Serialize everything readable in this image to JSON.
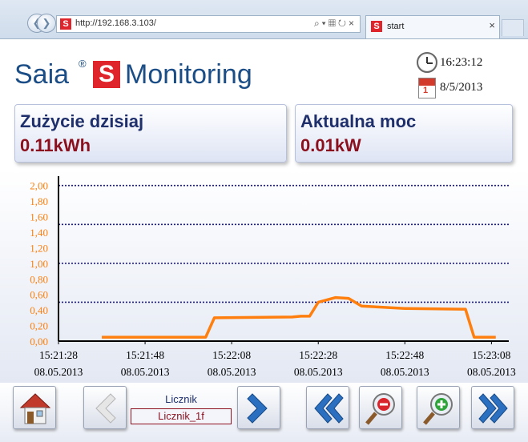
{
  "browser": {
    "url": "http://192.168.3.103/",
    "tab_title": "start",
    "favicon_letter": "S"
  },
  "logo": {
    "saia": "Saia",
    "reg": "®",
    "s": "S",
    "monitoring": "Monitoring"
  },
  "header": {
    "time": "16:23:12",
    "date": "8/5/2013"
  },
  "panels": {
    "energy": {
      "title": "Zużycie dzisiaj",
      "value": "0.11kWh"
    },
    "power": {
      "title": "Aktualna moc",
      "value": "0.01kW"
    }
  },
  "chart_data": {
    "type": "line",
    "y_ticks": [
      "2,00",
      "1,80",
      "1,60",
      "1,40",
      "1,20",
      "1,00",
      "0,80",
      "0,60",
      "0,40",
      "0,20",
      "0,00"
    ],
    "ylim": [
      0,
      2.1
    ],
    "x_ticks": [
      {
        "time": "15:21:28",
        "date": "08.05.2013"
      },
      {
        "time": "15:21:48",
        "date": "08.05.2013"
      },
      {
        "time": "15:22:08",
        "date": "08.05.2013"
      },
      {
        "time": "15:22:28",
        "date": "08.05.2013"
      },
      {
        "time": "15:22:48",
        "date": "08.05.2013"
      },
      {
        "time": "15:23:08",
        "date": "08.05.2013"
      }
    ],
    "x_seconds_start": "15:21:28",
    "xlim_seconds": [
      0,
      104
    ],
    "grid": "horizontal-dotted",
    "series": [
      {
        "color": "#ff7f0e",
        "points": [
          [
            10,
            0.05
          ],
          [
            34,
            0.05
          ],
          [
            36,
            0.3
          ],
          [
            54,
            0.31
          ],
          [
            56,
            0.32
          ],
          [
            58,
            0.32
          ],
          [
            60,
            0.5
          ],
          [
            64,
            0.56
          ],
          [
            67,
            0.55
          ],
          [
            70,
            0.45
          ],
          [
            80,
            0.42
          ],
          [
            93,
            0.41
          ],
          [
            94,
            0.41
          ],
          [
            96,
            0.05
          ],
          [
            101,
            0.05
          ]
        ]
      }
    ],
    "colors": {
      "axis": "#000000",
      "grid": "#1a1a9a",
      "tick_text": "#ff7f0e",
      "x_text": "#000000"
    }
  },
  "controls": {
    "licznik_label": "Licznik",
    "licznik_value": "Licznik_1f"
  }
}
